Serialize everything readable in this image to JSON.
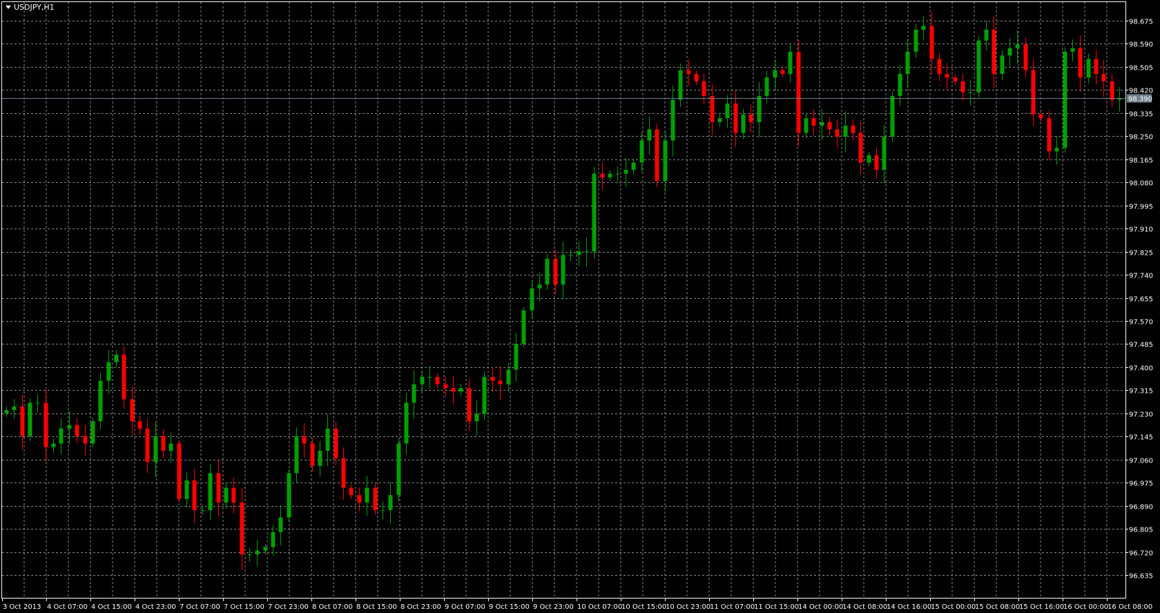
{
  "window": {
    "symbol_label": "USDJPY,H1"
  },
  "colors": {
    "bull": "#00a000",
    "bear": "#ff0000",
    "grid": "#8a8a8a",
    "axis": "#ffffff",
    "price_line": "#708090",
    "price_label_bg": "#6f7f8c"
  },
  "chart_data": {
    "type": "candlestick",
    "title": "USDJPY,H1",
    "current_price": "98.390",
    "ylim": [
      96.635,
      98.675
    ],
    "y_ticks": [
      "98.675",
      "98.590",
      "98.505",
      "98.420",
      "98.335",
      "98.250",
      "98.165",
      "98.080",
      "97.995",
      "97.910",
      "97.825",
      "97.740",
      "97.655",
      "97.570",
      "97.485",
      "97.400",
      "97.315",
      "97.230",
      "97.145",
      "97.060",
      "96.975",
      "96.890",
      "96.805",
      "96.720",
      "96.635"
    ],
    "x_ticks": [
      "3 Oct 2013",
      "4 Oct 07:00",
      "4 Oct 15:00",
      "4 Oct 23:00",
      "7 Oct 07:00",
      "7 Oct 15:00",
      "7 Oct 23:00",
      "8 Oct 07:00",
      "8 Oct 15:00",
      "8 Oct 23:00",
      "9 Oct 07:00",
      "9 Oct 15:00",
      "9 Oct 23:00",
      "10 Oct 07:00",
      "10 Oct 15:00",
      "10 Oct 23:00",
      "11 Oct 07:00",
      "11 Oct 15:00",
      "14 Oct 00:00",
      "14 Oct 08:00",
      "14 Oct 16:00",
      "15 Oct 00:00",
      "15 Oct 08:00",
      "15 Oct 16:00",
      "16 Oct 00:00",
      "16 Oct 08:00"
    ],
    "open_first": 97.23,
    "closes": [
      97.242,
      97.255,
      97.146,
      97.269,
      97.269,
      97.106,
      97.119,
      97.174,
      97.187,
      97.146,
      97.119,
      97.201,
      97.35,
      97.418,
      97.446,
      97.282,
      97.201,
      97.174,
      97.051,
      97.146,
      97.092,
      97.119,
      96.915,
      96.983,
      96.874,
      96.874,
      97.01,
      96.902,
      96.956,
      96.902,
      96.711,
      96.711,
      96.725,
      96.738,
      96.793,
      96.847,
      97.01,
      97.146,
      97.119,
      97.037,
      97.092,
      97.174,
      97.065,
      96.956,
      96.929,
      96.902,
      96.956,
      96.874,
      96.874,
      96.929,
      97.119,
      97.269,
      97.337,
      97.364,
      97.364,
      97.337,
      97.323,
      97.31,
      97.323,
      97.201,
      97.228,
      97.364,
      97.35,
      97.337,
      97.391,
      97.486,
      97.609,
      97.69,
      97.704,
      97.799,
      97.704,
      97.813,
      97.813,
      97.826,
      97.826,
      98.112,
      98.098,
      98.112,
      98.112,
      98.126,
      98.153,
      98.234,
      98.275,
      98.085,
      98.234,
      98.384,
      98.493,
      98.479,
      98.452,
      98.398,
      98.302,
      98.316,
      98.37,
      98.262,
      98.33,
      98.302,
      98.398,
      98.466,
      98.493,
      98.479,
      98.561,
      98.262,
      98.316,
      98.289,
      98.302,
      98.275,
      98.248,
      98.289,
      98.262,
      98.153,
      98.18,
      98.126,
      98.248,
      98.398,
      98.479,
      98.561,
      98.642,
      98.656,
      98.534,
      98.479,
      98.466,
      98.452,
      98.411,
      98.411,
      98.602,
      98.642,
      98.479,
      98.547,
      98.574,
      98.588,
      98.493,
      98.33,
      98.316,
      98.194,
      98.207,
      98.561,
      98.574,
      98.466,
      98.534,
      98.479,
      98.452,
      98.384,
      98.39
    ]
  }
}
